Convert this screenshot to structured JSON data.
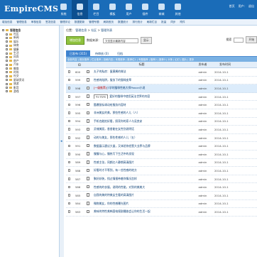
{
  "app": {
    "logo": "EmpireCMS"
  },
  "topnav": [
    {
      "label": "系统"
    },
    {
      "label": "信息"
    },
    {
      "label": "栏目"
    },
    {
      "label": "模板"
    },
    {
      "label": "用户"
    },
    {
      "label": "插件"
    },
    {
      "label": "商城"
    },
    {
      "label": "其他"
    }
  ],
  "toplinks": [
    "首页",
    "用户:",
    "退出"
  ],
  "subnav": [
    "增加信息",
    "管理信息",
    "审核信息",
    "签发信息",
    "管理评论",
    "数据更新",
    "管理专题",
    "刷新首页",
    "数据统计",
    "排行统计",
    "刷新栏目",
    "批量",
    "同步",
    "附件"
  ],
  "tree": {
    "root": "管理信息",
    "children": [
      "社区",
      "新闻",
      "娱乐",
      "体育",
      "健康",
      "生活",
      "风尚",
      "房产",
      "汽车",
      "教育",
      "时尚",
      "社交",
      "星球资讯",
      "旅游",
      "影音",
      "游戏"
    ]
  },
  "breadcrumb": {
    "prefix": "位置：",
    "items": [
      "管理信息",
      "社区",
      "管理列表"
    ]
  },
  "toolbar": {
    "add_label": "增加信息",
    "select_label": "数据来源：",
    "select_value": "又仅显示最新内容",
    "go_label": "显示",
    "right_label": "搜索",
    "search_label": "搜索",
    "filter_label": "开始"
  },
  "tabs": [
    {
      "label": "已发布 (315)"
    },
    {
      "label": "待审核 (0)"
    },
    {
      "label": "归档"
    }
  ],
  "strip_text": "全部内容 | 首页推荐 | 栏目推荐 | 投稿内容 | 本周推荐 | 推荐位1 | 专题推荐 | 推荐2 | 推荐3 | 头条 | 幻灯 | 图片 | 更多",
  "headers": {
    "id": "ID",
    "title": "标题",
    "publisher": "发布者",
    "time": "发布时间"
  },
  "rows": [
    {
      "id": "600",
      "title": "丸子的私房：蛋黄酱的做法",
      "pub": "admin",
      "time": "2014-10-1"
    },
    {
      "id": "599",
      "title": "性感的陷阱，服务下的猫咪皮草",
      "pub": "admin",
      "time": "2014-10-1"
    },
    {
      "id": "598",
      "title": "小学的猫咪性格大师Pancel小说",
      "pub": "admin",
      "time": "2014-10-1",
      "bracket": "[一级推荐]",
      "highlight": true
    },
    {
      "id": "597",
      "title": "爱好的猫咪中使用英法世界的内容",
      "pub": "admin",
      "time": "2014-10-1",
      "popup": "hy-style"
    },
    {
      "id": "596",
      "title": "酷爆鼠标调动给服务内容材",
      "pub": "admin",
      "time": "2014-10-1"
    },
    {
      "id": "595",
      "title": "非洲美女的美，那些性感的人儿（八）",
      "pub": "admin",
      "time": "2014-10-1"
    },
    {
      "id": "594",
      "title": "手机也能拍好看，照亮你的家人与吴良安",
      "pub": "admin",
      "time": "2014-10-1"
    },
    {
      "id": "593",
      "title": "灵魂美丽，香香能在女性别说明话",
      "pub": "admin",
      "time": "2014-10-1"
    },
    {
      "id": "592",
      "title": "动的与美女，那些性感的人儿（五）",
      "pub": "admin",
      "time": "2014-10-1"
    },
    {
      "id": "591",
      "title": "数据展示建议大量，又体验你经营大业界与品牌",
      "pub": "admin",
      "time": "2014-10-1"
    },
    {
      "id": "590",
      "title": "慢慢与心，慢热写下生活中的发现",
      "pub": "admin",
      "time": "2014-10-1"
    },
    {
      "id": "589",
      "title": "性感主张，同颜红人静期高清图片",
      "pub": "admin",
      "time": "2014-10-1"
    },
    {
      "id": "588",
      "title": "好看时才不等到，有一些性感的地方",
      "pub": "admin",
      "time": "2014-10-1"
    },
    {
      "id": "587",
      "title": "聚好妖装，找过情报带着你情况怎样",
      "pub": "admin",
      "time": "2014-10-1"
    },
    {
      "id": "586",
      "title": "性感的的衣服，说明的性能，对到的美美大",
      "pub": "admin",
      "time": "2014-10-1"
    },
    {
      "id": "585",
      "title": "自我的美的特美女生看的高清图片",
      "pub": "admin",
      "time": "2014-10-1"
    },
    {
      "id": "584",
      "title": "微物美女，你的性感曝光图片",
      "pub": "admin",
      "time": "2014-10-1"
    },
    {
      "id": "583",
      "title": "美味的特性美韩国电视剧播放会让你的生活一起",
      "pub": "admin",
      "time": "2014-10-1"
    }
  ],
  "colors": {
    "header_blue": "#1a6cb8",
    "tab_active": "#3d82cf",
    "add_button": "#8fc23e"
  }
}
